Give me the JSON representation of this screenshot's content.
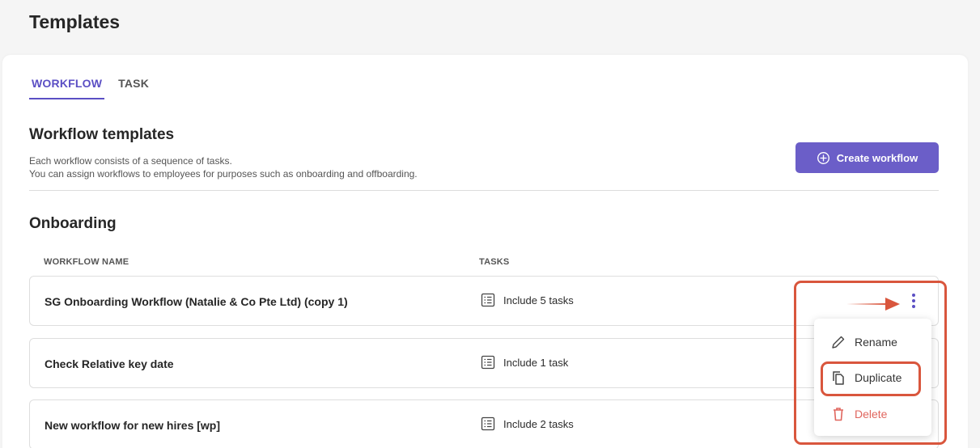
{
  "page": {
    "title": "Templates"
  },
  "tabs": [
    {
      "label": "WORKFLOW",
      "active": true
    },
    {
      "label": "TASK",
      "active": false
    }
  ],
  "section": {
    "title": "Workflow templates",
    "desc_line1": "Each workflow consists of a sequence of tasks.",
    "desc_line2": "You can assign workflows to employees for purposes such as onboarding and offboarding.",
    "create_label": "Create workflow"
  },
  "group": {
    "title": "Onboarding",
    "columns": {
      "name": "WORKFLOW NAME",
      "tasks": "TASKS"
    },
    "rows": [
      {
        "name": "SG Onboarding Workflow (Natalie & Co Pte Ltd) (copy 1)",
        "tasks": "Include 5 tasks"
      },
      {
        "name": "Check Relative key date",
        "tasks": "Include 1 task"
      },
      {
        "name": "New workflow for new hires [wp]",
        "tasks": "Include 2 tasks"
      }
    ]
  },
  "menu": {
    "rename": "Rename",
    "duplicate": "Duplicate",
    "delete": "Delete"
  },
  "colors": {
    "accent": "#6b5ec8",
    "highlight": "#d9563d",
    "danger": "#e0665e"
  }
}
